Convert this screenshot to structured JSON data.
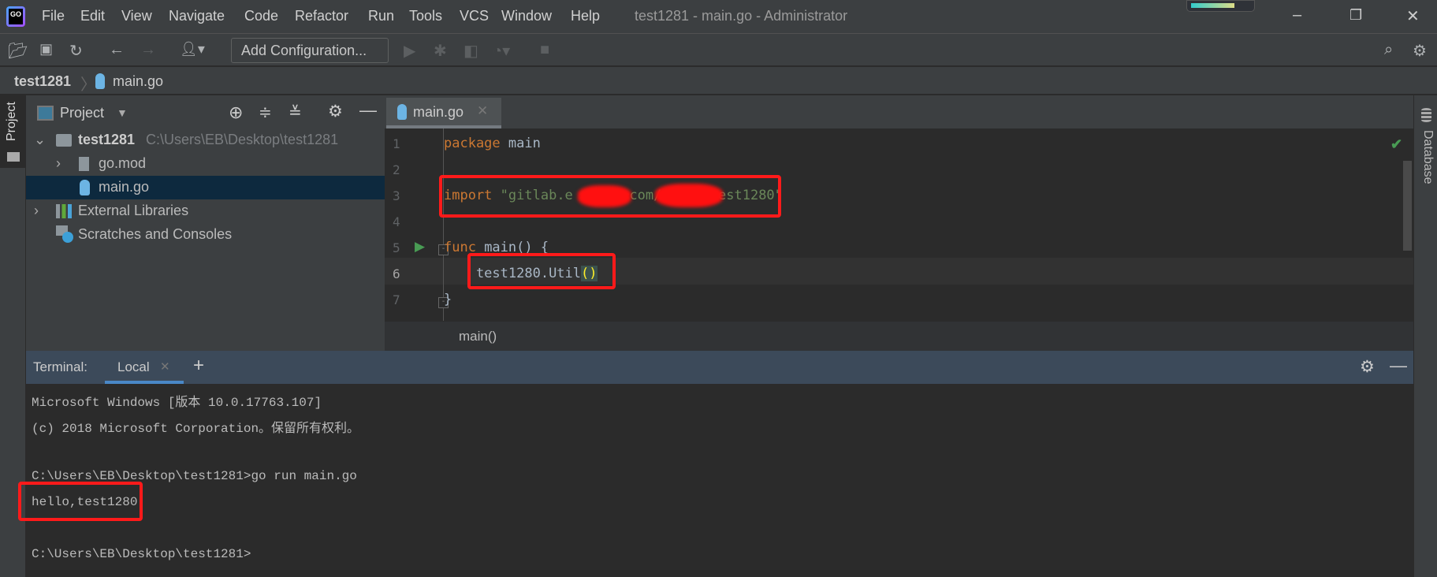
{
  "app": {
    "logo": "GO",
    "title": "test1281 - main.go - Administrator"
  },
  "menu": [
    "File",
    "Edit",
    "View",
    "Navigate",
    "Code",
    "Refactor",
    "Run",
    "Tools",
    "VCS",
    "Window",
    "Help"
  ],
  "toolbar": {
    "add_configuration": "Add Configuration..."
  },
  "breadcrumb": {
    "project": "test1281",
    "file": "main.go"
  },
  "left_strip": {
    "project_tab": "Project"
  },
  "right_strip": {
    "database_tab": "Database"
  },
  "project": {
    "header": "Project",
    "root": {
      "name": "test1281",
      "path": "C:\\Users\\EB\\Desktop\\test1281"
    },
    "items": [
      {
        "name": "go.mod"
      },
      {
        "name": "main.go",
        "selected": true
      },
      {
        "name": "External Libraries"
      },
      {
        "name": "Scratches and Consoles"
      }
    ]
  },
  "editor": {
    "tab": "main.go",
    "line_numbers": [
      "1",
      "2",
      "3",
      "4",
      "5",
      "6",
      "7"
    ],
    "code": {
      "l1_kw": "package",
      "l1_rest": " main",
      "l3_kw": "import",
      "l3_str": "\"gitlab.e     t.com/ebsme/test1280\"",
      "l5_kw": "func",
      "l5_rest": " main() {",
      "l6_a": "    test1280.",
      "l6_b": "Util",
      "l6_c": "()",
      "l7": "}"
    },
    "footer_breadcrumb": "main()",
    "status": "no-problems"
  },
  "terminal": {
    "label": "Terminal:",
    "tab": "Local",
    "lines": [
      "Microsoft Windows [版本 10.0.17763.107]",
      "(c) 2018 Microsoft Corporation。保留所有权利。",
      "",
      "C:\\Users\\EB\\Desktop\\test1281>go run main.go",
      "hello,test1280!",
      "",
      "C:\\Users\\EB\\Desktop\\test1281>"
    ]
  },
  "colors": {
    "highlight_box": "#ff1a1a",
    "keyword": "#cc7832",
    "string": "#6a8759",
    "selection": "#0d293e"
  }
}
